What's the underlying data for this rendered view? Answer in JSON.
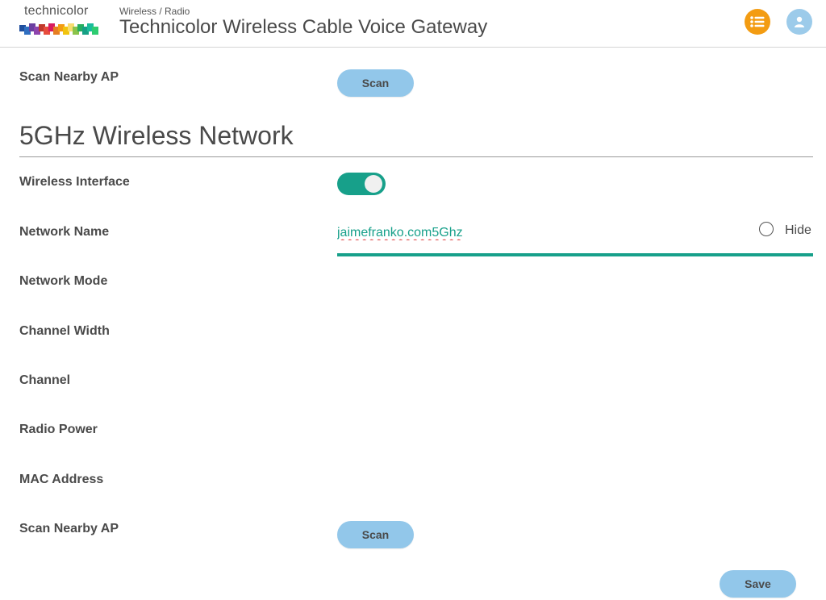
{
  "header": {
    "logo_text": "technicolor",
    "breadcrumb": "Wireless / Radio",
    "title": "Technicolor Wireless Cable Voice Gateway",
    "menu_icon": "list-icon",
    "user_icon": "user-icon",
    "menu_color": "#f39c12",
    "user_color": "#9ccbea"
  },
  "top_scan": {
    "label": "Scan Nearby AP",
    "button": "Scan"
  },
  "section": {
    "title": "5GHz Wireless Network"
  },
  "fields": {
    "wireless_interface": {
      "label": "Wireless Interface",
      "enabled": true
    },
    "network_name": {
      "label": "Network Name",
      "value": "jaimefranko.com5Ghz",
      "hide_label": "Hide",
      "hide_checked": false
    },
    "network_mode": {
      "label": "Network Mode"
    },
    "channel_width": {
      "label": "Channel Width"
    },
    "channel": {
      "label": "Channel"
    },
    "radio_power": {
      "label": "Radio Power"
    },
    "mac_address": {
      "label": "MAC Address"
    },
    "scan_nearby": {
      "label": "Scan Nearby AP",
      "button": "Scan"
    }
  },
  "actions": {
    "save": "Save"
  },
  "colors": {
    "accent": "#17a08a",
    "button": "#92c7ea"
  }
}
